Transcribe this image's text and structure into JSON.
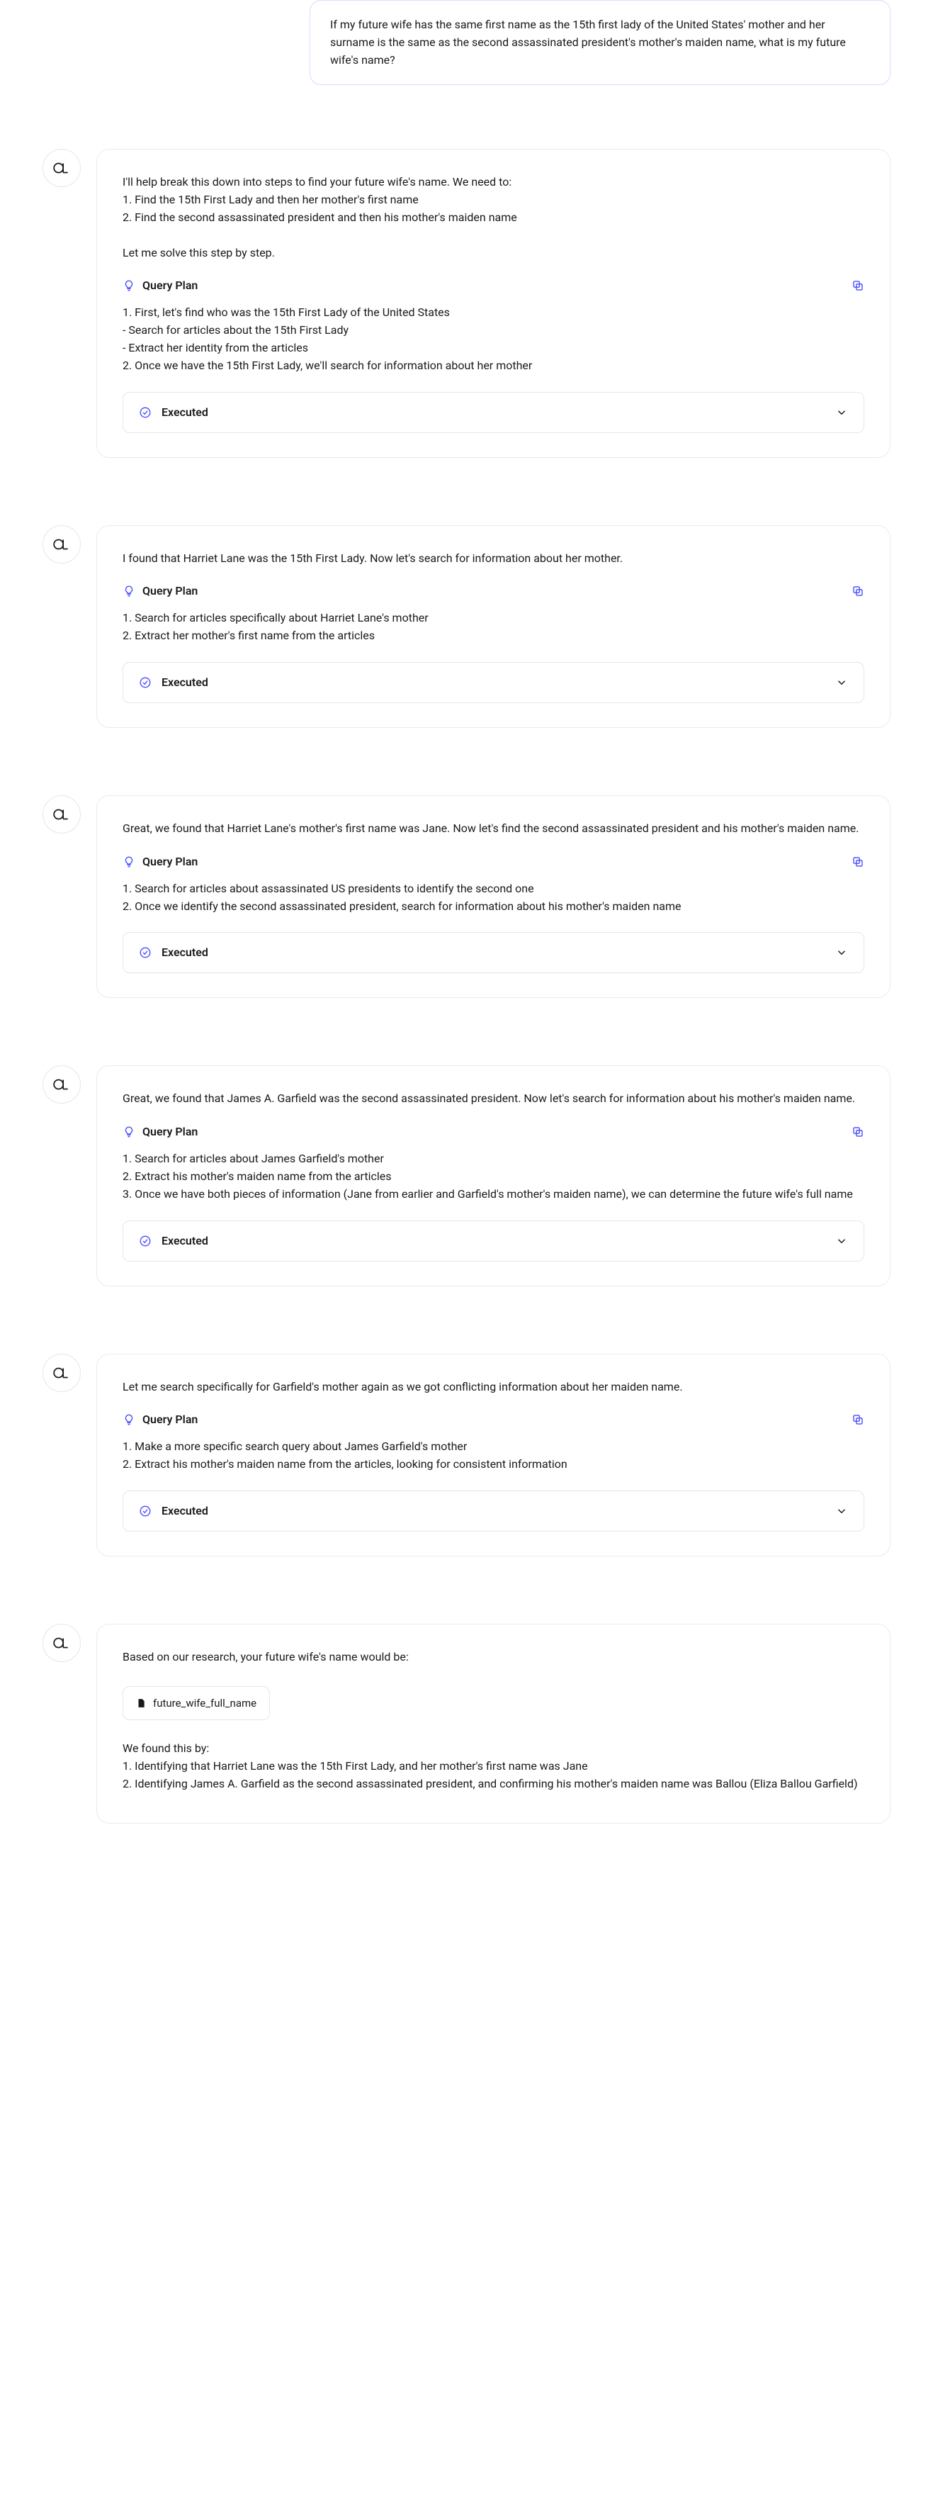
{
  "user_message": "If my future wife has the same first name as the 15th first lady of the United States' mother and her surname is the same as the second assassinated president's mother's maiden name, what is my future wife's name?",
  "query_plan_label": "Query Plan",
  "executed_label": "Executed",
  "blocks": [
    {
      "intro": "I'll help break this down into steps to find your future wife's name. We need to:\n1. Find the 15th First Lady and then her mother's first name\n2. Find the second assassinated president and then his mother's maiden name\n\nLet me solve this step by step.",
      "plan": "1. First, let's find who was the 15th First Lady of the United States\n- Search for articles about the 15th First Lady\n- Extract her identity from the articles\n2. Once we have the 15th First Lady, we'll search for information about her mother"
    },
    {
      "intro": "I found that Harriet Lane was the 15th First Lady. Now let's search for information about her mother.",
      "plan": "1. Search for articles specifically about Harriet Lane's mother\n2. Extract her mother's first name from the articles"
    },
    {
      "intro": "Great, we found that Harriet Lane's mother's first name was Jane. Now let's find the second assassinated president and his mother's maiden name.",
      "plan": "1. Search for articles about assassinated US presidents to identify the second one\n2. Once we identify the second assassinated president, search for information about his mother's maiden name"
    },
    {
      "intro": "Great, we found that James A. Garfield was the second assassinated president. Now let's search for information about his mother's maiden name.",
      "plan": "1. Search for articles about James Garfield's mother\n2. Extract his mother's maiden name from the articles\n3. Once we have both pieces of information (Jane from earlier and Garfield's mother's maiden name), we can determine the future wife's full name"
    },
    {
      "intro": "Let me search specifically for Garfield's mother again as we got conflicting information about her maiden name.",
      "plan": "1. Make a more specific search query about James Garfield's mother\n2. Extract his mother's maiden name from the articles, looking for consistent information"
    }
  ],
  "final": {
    "intro": "Based on our research, your future wife's name would be:",
    "chip_label": "future_wife_full_name",
    "outro": "We found this by:\n1. Identifying that Harriet Lane was the 15th First Lady, and her mother's first name was Jane\n2. Identifying James A. Garfield as the second assassinated president, and confirming his mother's maiden name was Ballou (Eliza Ballou Garfield)"
  }
}
